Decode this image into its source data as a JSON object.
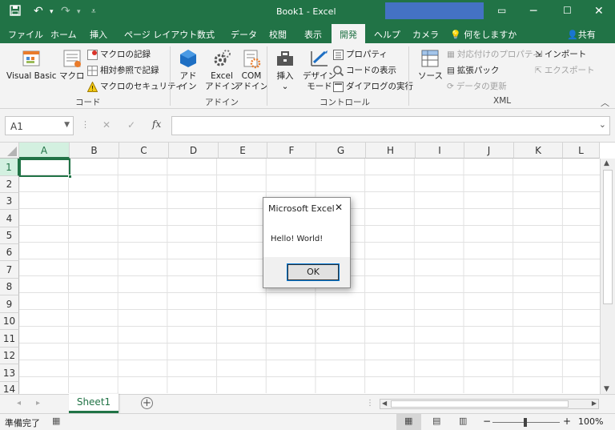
{
  "title": {
    "doc": "Book1",
    "sep": "-",
    "app": "Excel"
  },
  "qat": {
    "save_icon": "save-icon",
    "undo_icon": "undo-icon",
    "redo_icon": "redo-icon"
  },
  "tabs": [
    "ファイル",
    "ホーム",
    "挿入",
    "ページ レイアウト",
    "数式",
    "データ",
    "校閲",
    "表示",
    "開発",
    "ヘルプ",
    "カメラ"
  ],
  "tell_me": "何をしますか",
  "share": "共有",
  "ribbon": {
    "code": {
      "vb": "Visual Basic",
      "macro": "マクロ",
      "record": "マクロの記録",
      "relative": "相対参照で記録",
      "security": "マクロのセキュリティ",
      "group": "コード"
    },
    "addins": {
      "addin_l1": "アド",
      "addin_l2": "イン",
      "excel_l1": "Excel",
      "excel_l2": "アドイン",
      "com_l1": "COM",
      "com_l2": "アドイン",
      "group": "アドイン"
    },
    "controls": {
      "insert": "挿入",
      "design_l1": "デザイン",
      "design_l2": "モード",
      "props": "プロパティ",
      "viewcode": "コードの表示",
      "rundialog": "ダイアログの実行",
      "group": "コントロール"
    },
    "xml": {
      "source": "ソース",
      "mapprops": "対応付けのプロパティ",
      "expansion": "拡張パック",
      "refresh": "データの更新",
      "import": "インポート",
      "export": "エクスポート",
      "group": "XML"
    }
  },
  "formula": {
    "namebox": "A1",
    "cancel": "✕",
    "enter": "✓",
    "fx": "fx",
    "value": ""
  },
  "columns": [
    "A",
    "B",
    "C",
    "D",
    "E",
    "F",
    "G",
    "H",
    "I",
    "J",
    "K",
    "L"
  ],
  "rows": [
    "1",
    "2",
    "3",
    "4",
    "5",
    "6",
    "7",
    "8",
    "9",
    "10",
    "11",
    "12",
    "13",
    "14"
  ],
  "sheet": {
    "tab": "Sheet1",
    "add": "+"
  },
  "status": {
    "ready": "準備完了",
    "zoom": "100%",
    "minus": "−",
    "plus": "+"
  },
  "dialog": {
    "title": "Microsoft Excel",
    "message": "Hello! World!",
    "ok": "OK",
    "close": "✕"
  },
  "colors": {
    "accent": "#217346",
    "selection": "#217346"
  }
}
